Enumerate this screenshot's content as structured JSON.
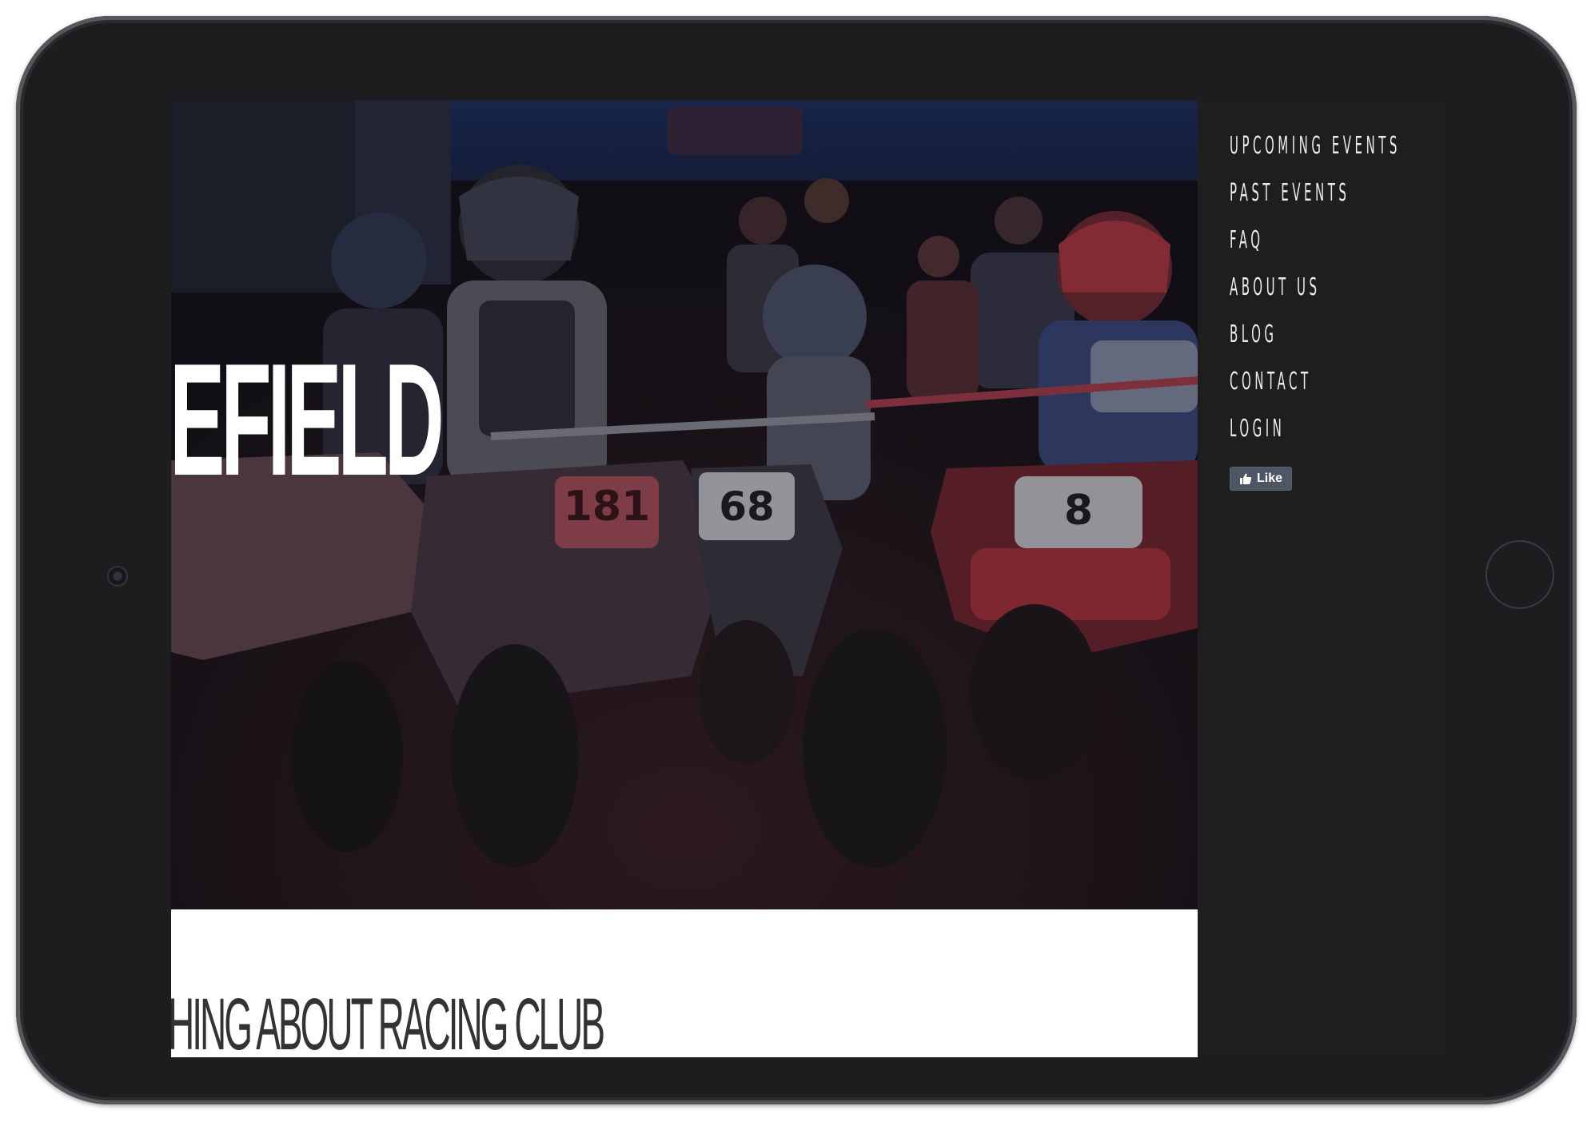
{
  "hero": {
    "title": "EFIELD",
    "quad_numbers": [
      "181",
      "68",
      "8"
    ]
  },
  "main": {
    "heading": "HING ABOUT RACING CLUB"
  },
  "sidebar": {
    "nav": [
      {
        "label": "UPCOMING EVENTS"
      },
      {
        "label": "PAST EVENTS"
      },
      {
        "label": "FAQ"
      },
      {
        "label": "ABOUT US"
      },
      {
        "label": "BLOG"
      },
      {
        "label": "CONTACT"
      },
      {
        "label": "LOGIN"
      }
    ],
    "like_label": "Like"
  }
}
